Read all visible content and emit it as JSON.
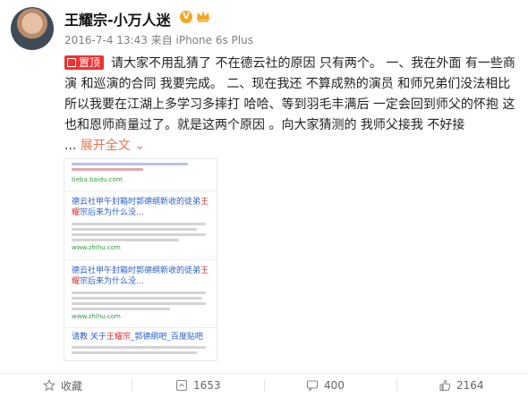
{
  "user": {
    "name": "王耀宗-小万人迷"
  },
  "post": {
    "meta": "2016-7-4 13:43 来自 iPhone 6s Plus",
    "pin_label": "置顶",
    "text": "请大家不用乱猜了 不在德云社的原因 只有两个。 一、我在外面 有一些商演 和巡演的合同 我要完成。 二、现在我还 不算成熟的演员 和师兄弟们没法相比 所以我要在江湖上多学习多摔打 哈哈、等到羽毛丰满后 一定会回到师父的怀抱 这也和恩师商量过了。就是这两个原因 。向大家猜测的 我师父接我 不好接",
    "ellipsis": "...",
    "expand_label": "展开全文",
    "expand_arrow": "⌄"
  },
  "image": {
    "results": [
      {
        "title_plain": "德云社甲午封箱时郭德纲新收的徒弟",
        "title_hl": "王耀",
        "title_rest": "宗后来为什么没...",
        "url": "www.zhihu.com"
      },
      {
        "title_plain": "德云社甲午封箱时郭德纲新收的徒弟",
        "title_hl": "王耀",
        "title_rest": "宗后来为什么没...",
        "url": "www.zhihu.com"
      },
      {
        "title_plain": "请教 关于",
        "title_hl": "王耀宗",
        "title_rest": "_郭德纲吧_百度贴吧",
        "url": ""
      }
    ],
    "top_url": "tieba.baidu.com"
  },
  "actions": {
    "favorite": {
      "label": "收藏"
    },
    "repost": {
      "count": "1653"
    },
    "comment": {
      "count": "400"
    },
    "like": {
      "count": "2164"
    }
  },
  "colors": {
    "accent": "#eb7350",
    "pin": "#e33333",
    "link": "#2b5ec7"
  }
}
